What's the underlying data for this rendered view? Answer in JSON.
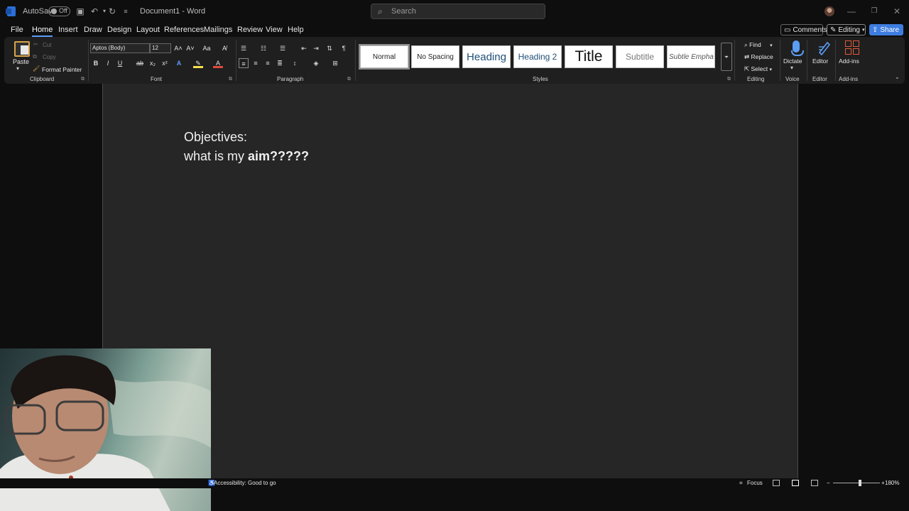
{
  "titlebar": {
    "autosave_label": "AutoSave",
    "autosave_state": "Off",
    "doc_title": "Document1  -  Word",
    "search_placeholder": "Search"
  },
  "menu": {
    "tabs": [
      "File",
      "Home",
      "Insert",
      "Draw",
      "Design",
      "Layout",
      "References",
      "Mailings",
      "Review",
      "View",
      "Help"
    ],
    "active_tab": "Home",
    "comments_label": "Comments",
    "editing_label": "Editing",
    "share_label": "Share"
  },
  "ribbon": {
    "clipboard": {
      "paste_label": "Paste",
      "cut_label": "Cut",
      "copy_label": "Copy",
      "format_painter_label": "Format Painter",
      "group_label": "Clipboard"
    },
    "font": {
      "font_name": "Aptos (Body)",
      "font_size": "12",
      "group_label": "Font"
    },
    "paragraph": {
      "group_label": "Paragraph"
    },
    "styles": {
      "items": [
        "Normal",
        "No Spacing",
        "Heading",
        "Heading 2",
        "Title",
        "Subtitle",
        "Subtle Empha"
      ],
      "group_label": "Styles"
    },
    "editing": {
      "find_label": "Find",
      "replace_label": "Replace",
      "select_label": "Select",
      "group_label": "Editing"
    },
    "voice": {
      "dictate_label": "Dictate",
      "group_label": "Voice"
    },
    "editor": {
      "editor_label": "Editor",
      "group_label": "Editor"
    },
    "addins": {
      "addins_label": "Add-ins",
      "group_label": "Add-ins"
    }
  },
  "document": {
    "line1": "Objectives:",
    "line2_prefix": "what is my ",
    "line2_bold": "aim?????"
  },
  "statusbar": {
    "accessibility": "Accessibility: Good to go",
    "focus_label": "Focus",
    "zoom_level": "180%"
  },
  "colors": {
    "accent": "#5b9cf5",
    "share_bg": "#3e7de0",
    "page_bg": "#262626",
    "ribbon_bg": "#1f1f1f"
  }
}
